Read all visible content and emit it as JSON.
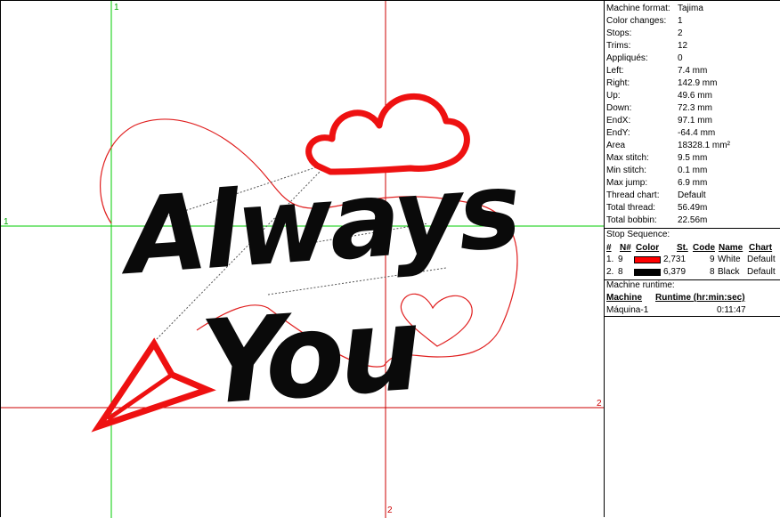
{
  "guides": {
    "label_1_top": "1",
    "label_1_left": "1",
    "label_2_right": "2",
    "label_2_bottom": "2"
  },
  "design": {
    "text_line1": "Always",
    "text_line2": "You",
    "colors": {
      "red": "#ee1111",
      "black": "#0a0a0a",
      "guide_green": "#00cc00",
      "guide_red": "#cc0000"
    }
  },
  "info": {
    "rows": [
      {
        "label": "Machine format:",
        "value": "Tajima"
      },
      {
        "label": "Color changes:",
        "value": "1"
      },
      {
        "label": "Stops:",
        "value": "2"
      },
      {
        "label": "Trims:",
        "value": "12"
      },
      {
        "label": "Appliqués:",
        "value": "0"
      },
      {
        "label": "Left:",
        "value": "7.4 mm"
      },
      {
        "label": "Right:",
        "value": "142.9 mm"
      },
      {
        "label": "Up:",
        "value": "49.6 mm"
      },
      {
        "label": "Down:",
        "value": "72.3 mm"
      },
      {
        "label": "EndX:",
        "value": "97.1 mm"
      },
      {
        "label": "EndY:",
        "value": "-64.4 mm"
      },
      {
        "label": "Area",
        "value": "18328.1 mm²"
      },
      {
        "label": "Max stitch:",
        "value": "9.5 mm"
      },
      {
        "label": "Min stitch:",
        "value": "0.1 mm"
      },
      {
        "label": "Max jump:",
        "value": "6.9 mm"
      },
      {
        "label": "Thread chart:",
        "value": "Default"
      },
      {
        "label": "Total thread:",
        "value": "56.49m"
      },
      {
        "label": "Total bobbin:",
        "value": "22.56m"
      }
    ]
  },
  "stop_sequence": {
    "title": "Stop Sequence:",
    "headers": {
      "num": "#",
      "n": "N#",
      "color": "Color",
      "st": "St.",
      "code": "Code",
      "name": "Name",
      "chart": "Chart"
    },
    "rows": [
      {
        "num": "1.",
        "n": "9",
        "swatch": "#ff0000",
        "st": "2,731",
        "code": "9",
        "name": "White",
        "chart": "Default"
      },
      {
        "num": "2.",
        "n": "8",
        "swatch": "#000000",
        "st": "6,379",
        "code": "8",
        "name": "Black",
        "chart": "Default"
      }
    ]
  },
  "runtime": {
    "title": "Machine runtime:",
    "headers": {
      "machine": "Machine",
      "runtime": "Runtime (hr:min:sec)"
    },
    "rows": [
      {
        "machine": "Máquina-1",
        "runtime": "0:11:47"
      }
    ]
  }
}
